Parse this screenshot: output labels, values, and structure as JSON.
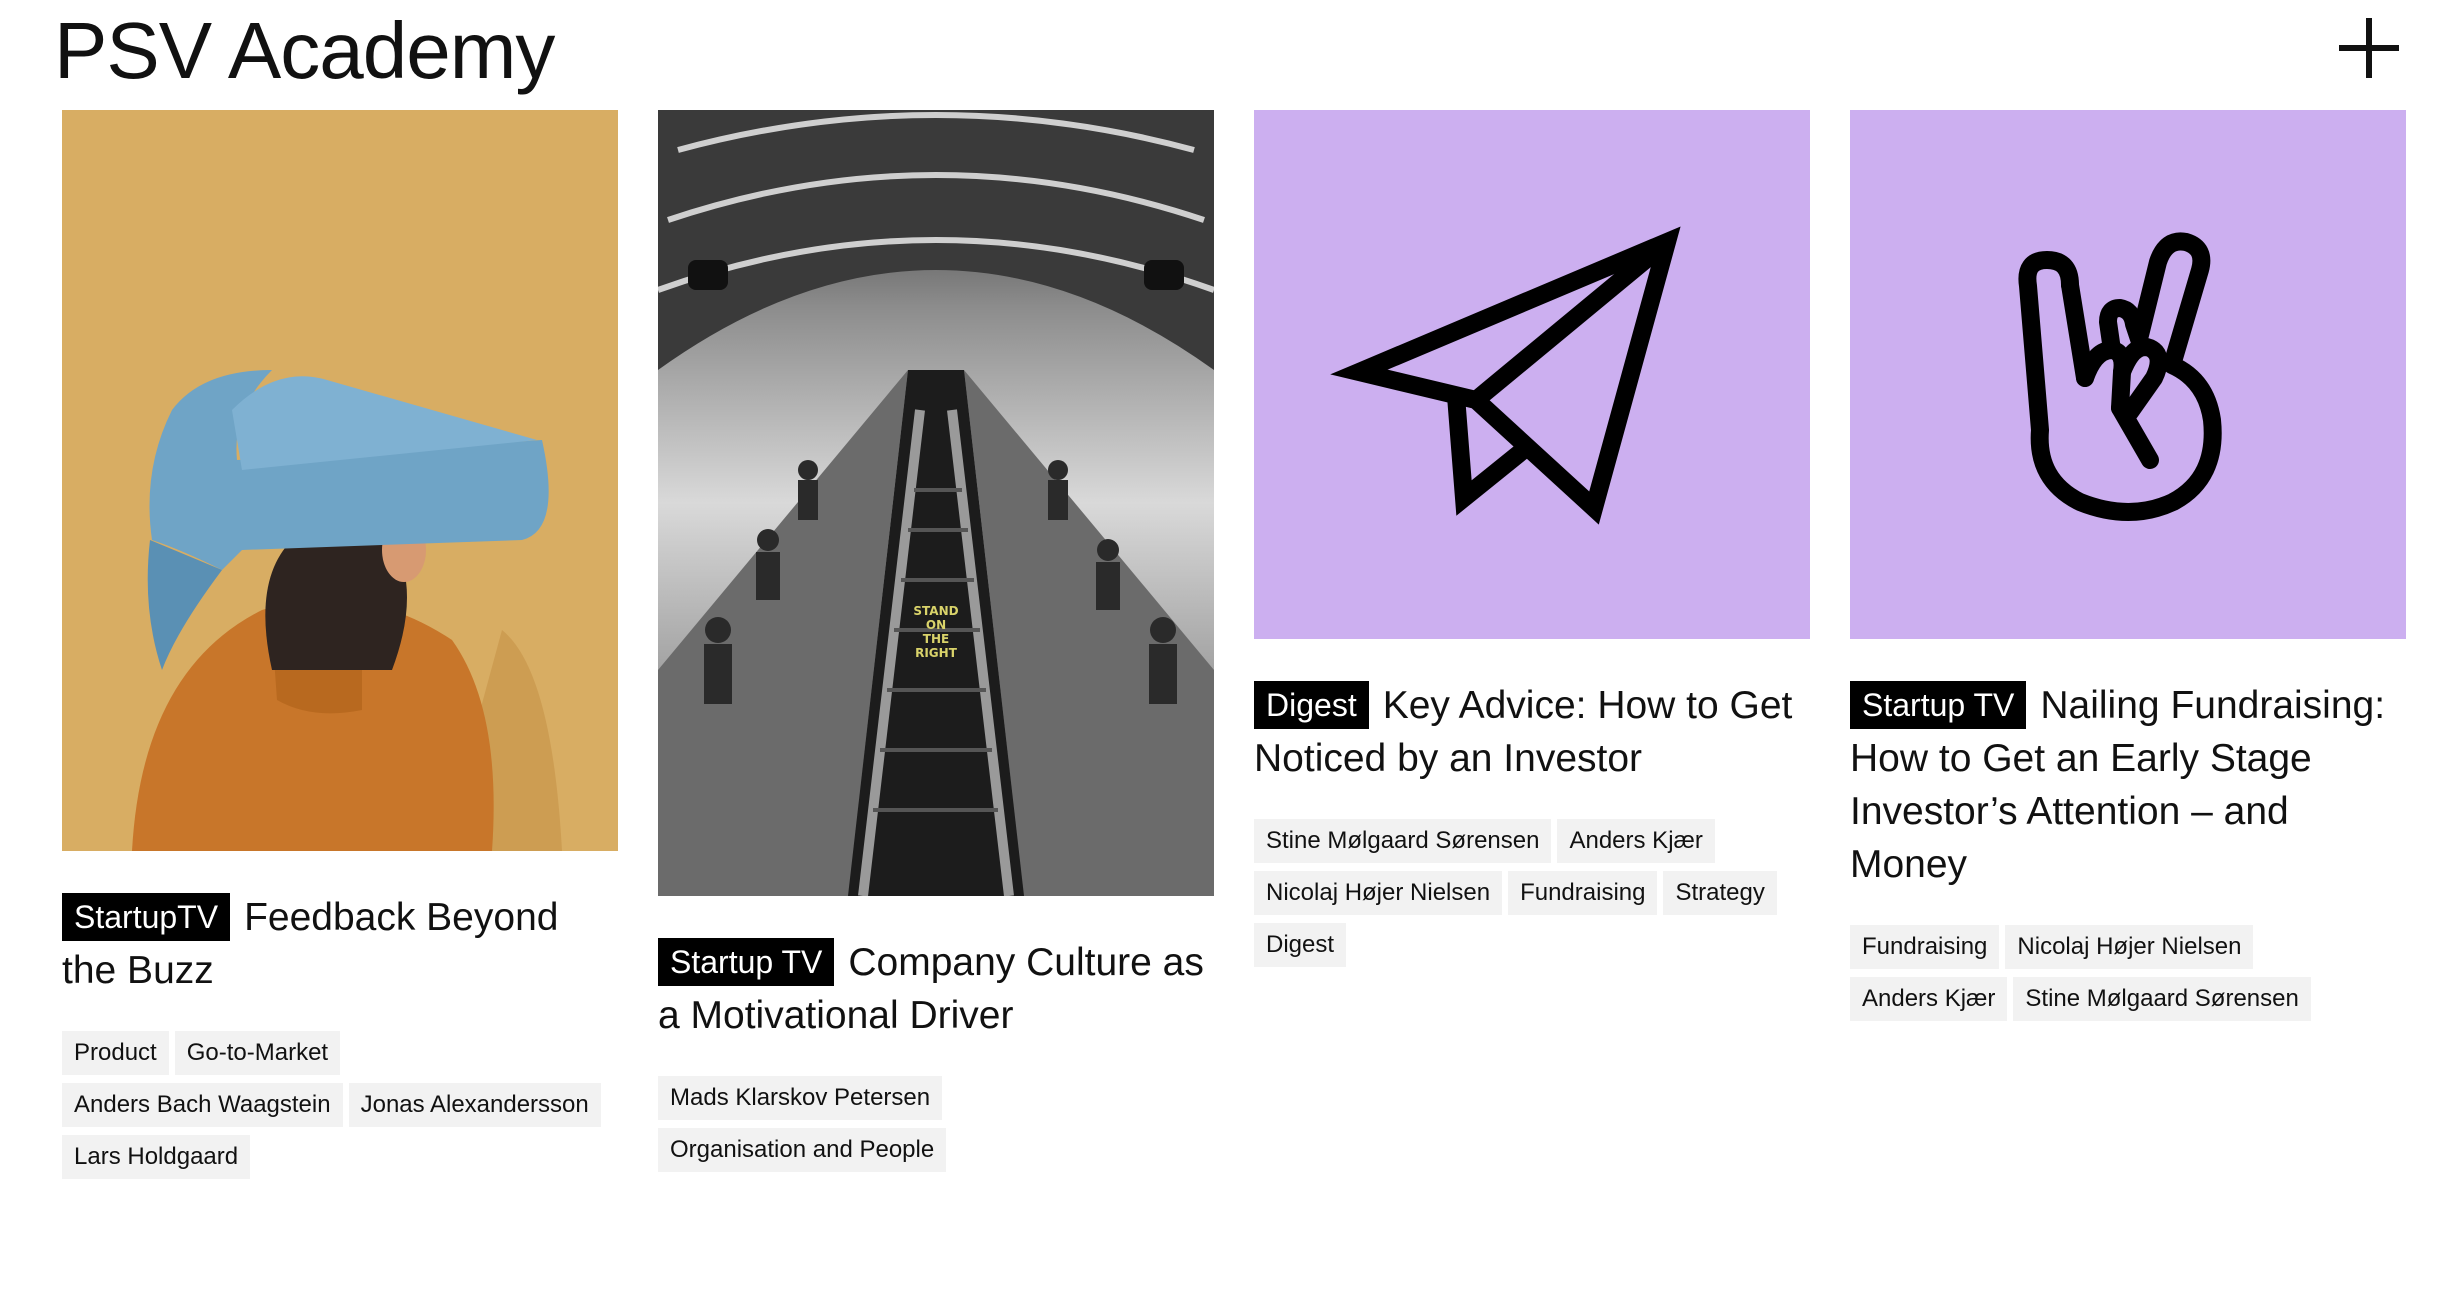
{
  "header": {
    "logo": "PSV Academy",
    "menu_icon": "plus-icon"
  },
  "colors": {
    "lilac": "#ccaff0",
    "badge_bg": "#000000",
    "tag_bg": "#f2f2f2"
  },
  "cards": [
    {
      "image_icon": "photo-person-paper-hat",
      "badge": "StartupTV",
      "title": "Feedback Beyond the Buzz",
      "tags": [
        "Product",
        "Go-to-Market",
        "Anders Bach Waagstein",
        "Jonas Alexandersson",
        "Lars Holdgaard"
      ]
    },
    {
      "image_icon": "photo-escalator",
      "image_text": [
        "STAND",
        "ON",
        "THE",
        "RIGHT"
      ],
      "badge": "Startup TV",
      "title": "Company Culture as a Motivational Driver",
      "tags": [
        "Mads Klarskov Petersen",
        "Organisation and People"
      ]
    },
    {
      "image_icon": "paper-plane-icon",
      "badge": "Digest",
      "title": "Key Advice: How to Get Noticed by an Investor",
      "tags": [
        "Stine Mølgaard Sørensen",
        "Anders Kjær",
        "Nicolaj Højer Nielsen",
        "Fundraising",
        "Strategy",
        "Digest"
      ]
    },
    {
      "image_icon": "rock-hand-icon",
      "badge": "Startup TV",
      "title": "Nailing Fundraising: How to Get an Early Stage Investor’s Attention – and Money",
      "tags": [
        "Fundraising",
        "Nicolaj Højer Nielsen",
        "Anders Kjær",
        "Stine Mølgaard Sørensen"
      ]
    }
  ]
}
